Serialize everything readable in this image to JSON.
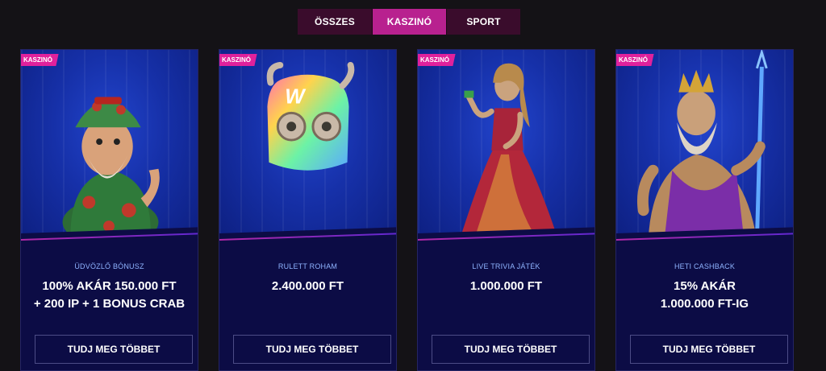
{
  "tabs": [
    {
      "label": "ÖSSZES",
      "active": false
    },
    {
      "label": "KASZINÓ",
      "active": true
    },
    {
      "label": "SPORT",
      "active": false
    }
  ],
  "cards": [
    {
      "badge": "KASZINÓ",
      "subtitle": "ÜDVÖZLŐ BÓNUSZ",
      "offer_line1": "100% AKÁR 150.000 FT",
      "offer_line2": "+ 200 IP + 1 BONUS CRAB",
      "button": "TUDJ MEG TÖBBET",
      "art": "gonzo-character"
    },
    {
      "badge": "KASZINÓ",
      "subtitle": "RULETT ROHAM",
      "offer_line1": "2.400.000 FT",
      "offer_line2": "",
      "button": "TUDJ MEG TÖBBET",
      "art": "colorful-mask-helmet"
    },
    {
      "badge": "KASZINÓ",
      "subtitle": "LIVE TRIVIA JÁTÉK",
      "offer_line1": "1.000.000 FT",
      "offer_line2": "",
      "button": "TUDJ MEG TÖBBET",
      "art": "woman-in-dress"
    },
    {
      "badge": "KASZINÓ",
      "subtitle": "HETI CASHBACK",
      "offer_line1": "15% AKÁR",
      "offer_line2": "1.000.000 FT-IG",
      "button": "TUDJ MEG TÖBBET",
      "art": "zeus-character"
    }
  ],
  "colors": {
    "accent": "#b8218f",
    "badge": "#e0219c",
    "card_bg": "#0c0c45",
    "subtitle": "#8fb4ff"
  }
}
